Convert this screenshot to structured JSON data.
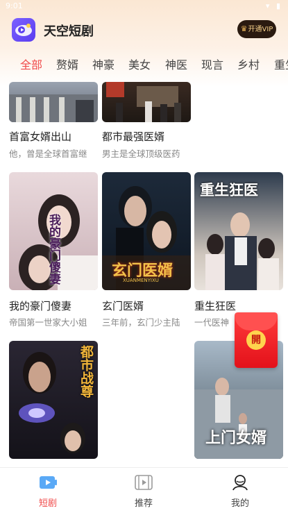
{
  "status_bar": {
    "time": "9:01"
  },
  "app": {
    "title": "天空短剧",
    "vip_label": "开通VIP"
  },
  "tabs": [
    "全部",
    "赘婿",
    "神豪",
    "美女",
    "神医",
    "现言",
    "乡村",
    "重生"
  ],
  "active_tab": 0,
  "cards": [
    {
      "title": "首富女婿出山",
      "desc": "他，曾是全球首富继"
    },
    {
      "title": "都市最强医婿",
      "desc": "男主是全球顶级医药"
    },
    {
      "title": "我的豪门傻妻",
      "desc": "帝国第一世家大小姐",
      "poster_text": "我的豪门傻妻"
    },
    {
      "title": "玄门医婿",
      "desc": "三年前，玄门少主陆",
      "poster_text": "玄门医婿",
      "poster_sub": "XUANMENYIXU"
    },
    {
      "title": "重生狂医",
      "desc": "一代医神",
      "poster_text": "重生狂医"
    },
    {
      "poster_text": "都市战尊"
    },
    {
      "poster_text": "上门女婿"
    }
  ],
  "red_packet": {
    "label": "開"
  },
  "bottom_nav": [
    {
      "label": "短剧",
      "icon": "drama-icon"
    },
    {
      "label": "推荐",
      "icon": "recommend-icon"
    },
    {
      "label": "我的",
      "icon": "profile-icon"
    }
  ],
  "colors": {
    "accent": "#f04a4a",
    "vip_bg": "#2a1a10",
    "vip_text": "#f5d08a"
  }
}
